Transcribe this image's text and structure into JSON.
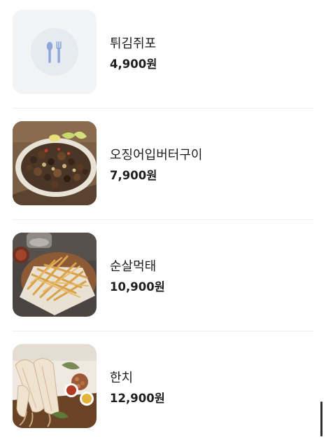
{
  "menu": {
    "items": [
      {
        "name": "튀김쥐포",
        "price": "4,900원",
        "image": "placeholder-utensils-icon"
      },
      {
        "name": "오징어입버터구이",
        "price": "7,900원",
        "image": "squid-mouth-butter-grill-photo"
      },
      {
        "name": "순살먹태",
        "price": "10,900원",
        "image": "shredded-dried-pollack-photo"
      },
      {
        "name": "한치",
        "price": "12,900원",
        "image": "dried-squid-platter-photo"
      }
    ]
  },
  "colors": {
    "placeholder_bg": "#f3f4f6",
    "placeholder_circle": "#e6eaf1",
    "placeholder_icon": "#8ea7d8",
    "divider": "#eeeeee",
    "text": "#1e1e1e"
  }
}
